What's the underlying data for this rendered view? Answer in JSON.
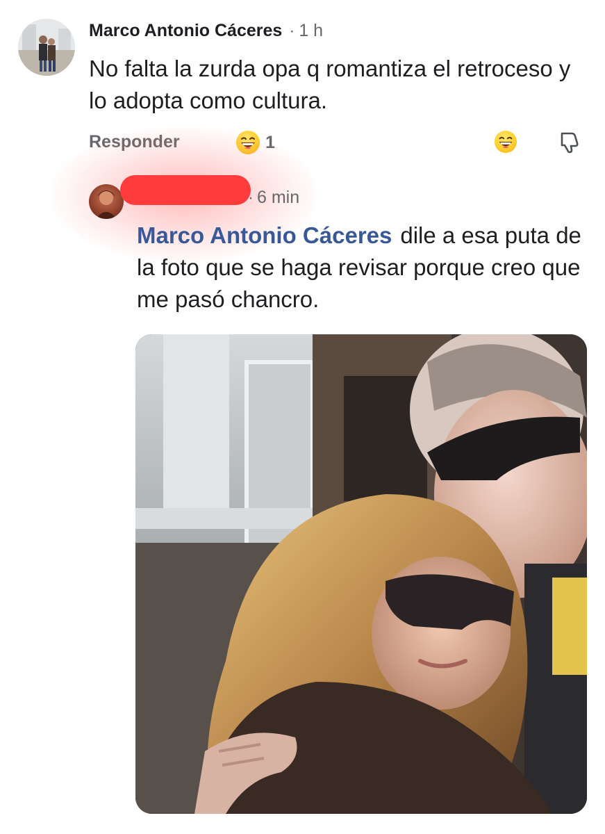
{
  "parent_comment": {
    "author": "Marco Antonio Cáceres",
    "separator": "·",
    "time": "1 h",
    "text": "No falta la zurda opa q romantiza el retroceso y lo adopta como cultura.",
    "reply_label": "Responder",
    "reaction_icon": "laughing-emoji-icon",
    "reaction_count": "1"
  },
  "reply": {
    "author_redacted": true,
    "separator": "·",
    "time": "6 min",
    "mention": "Marco Antonio Cáceres",
    "text": "dile a esa puta de la foto que se haga revisar porque creo que me pasó chancro.",
    "attachment": "photo-attachment"
  },
  "colors": {
    "name_text": "#1c1e21",
    "meta_text": "#65676b",
    "mention": "#385898",
    "redaction": "#ff3b3b",
    "highlight": "#ff5050"
  }
}
